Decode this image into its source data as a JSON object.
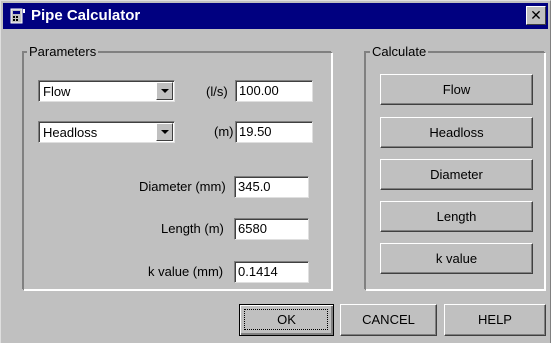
{
  "window": {
    "title": "Pipe Calculator",
    "close_symbol": "✕"
  },
  "parameters": {
    "group_label": "Parameters",
    "select1": {
      "value": "Flow",
      "unit": "(l/s)",
      "input": "100.00"
    },
    "select2": {
      "value": "Headloss",
      "unit": "(m)",
      "input": "19.50"
    },
    "diameter": {
      "label": "Diameter (mm)",
      "value": "345.0"
    },
    "length": {
      "label": "Length (m)",
      "value": "6580"
    },
    "kvalue": {
      "label": "k value (mm)",
      "value": "0.1414"
    }
  },
  "calculate": {
    "group_label": "Calculate",
    "buttons": [
      "Flow",
      "Headloss",
      "Diameter",
      "Length",
      "k value"
    ]
  },
  "footer": {
    "ok": "OK",
    "cancel": "CANCEL",
    "help": "HELP"
  },
  "icons": {
    "app": "calculator-icon",
    "close": "close-icon",
    "dropdown": "chevron-down-icon"
  }
}
